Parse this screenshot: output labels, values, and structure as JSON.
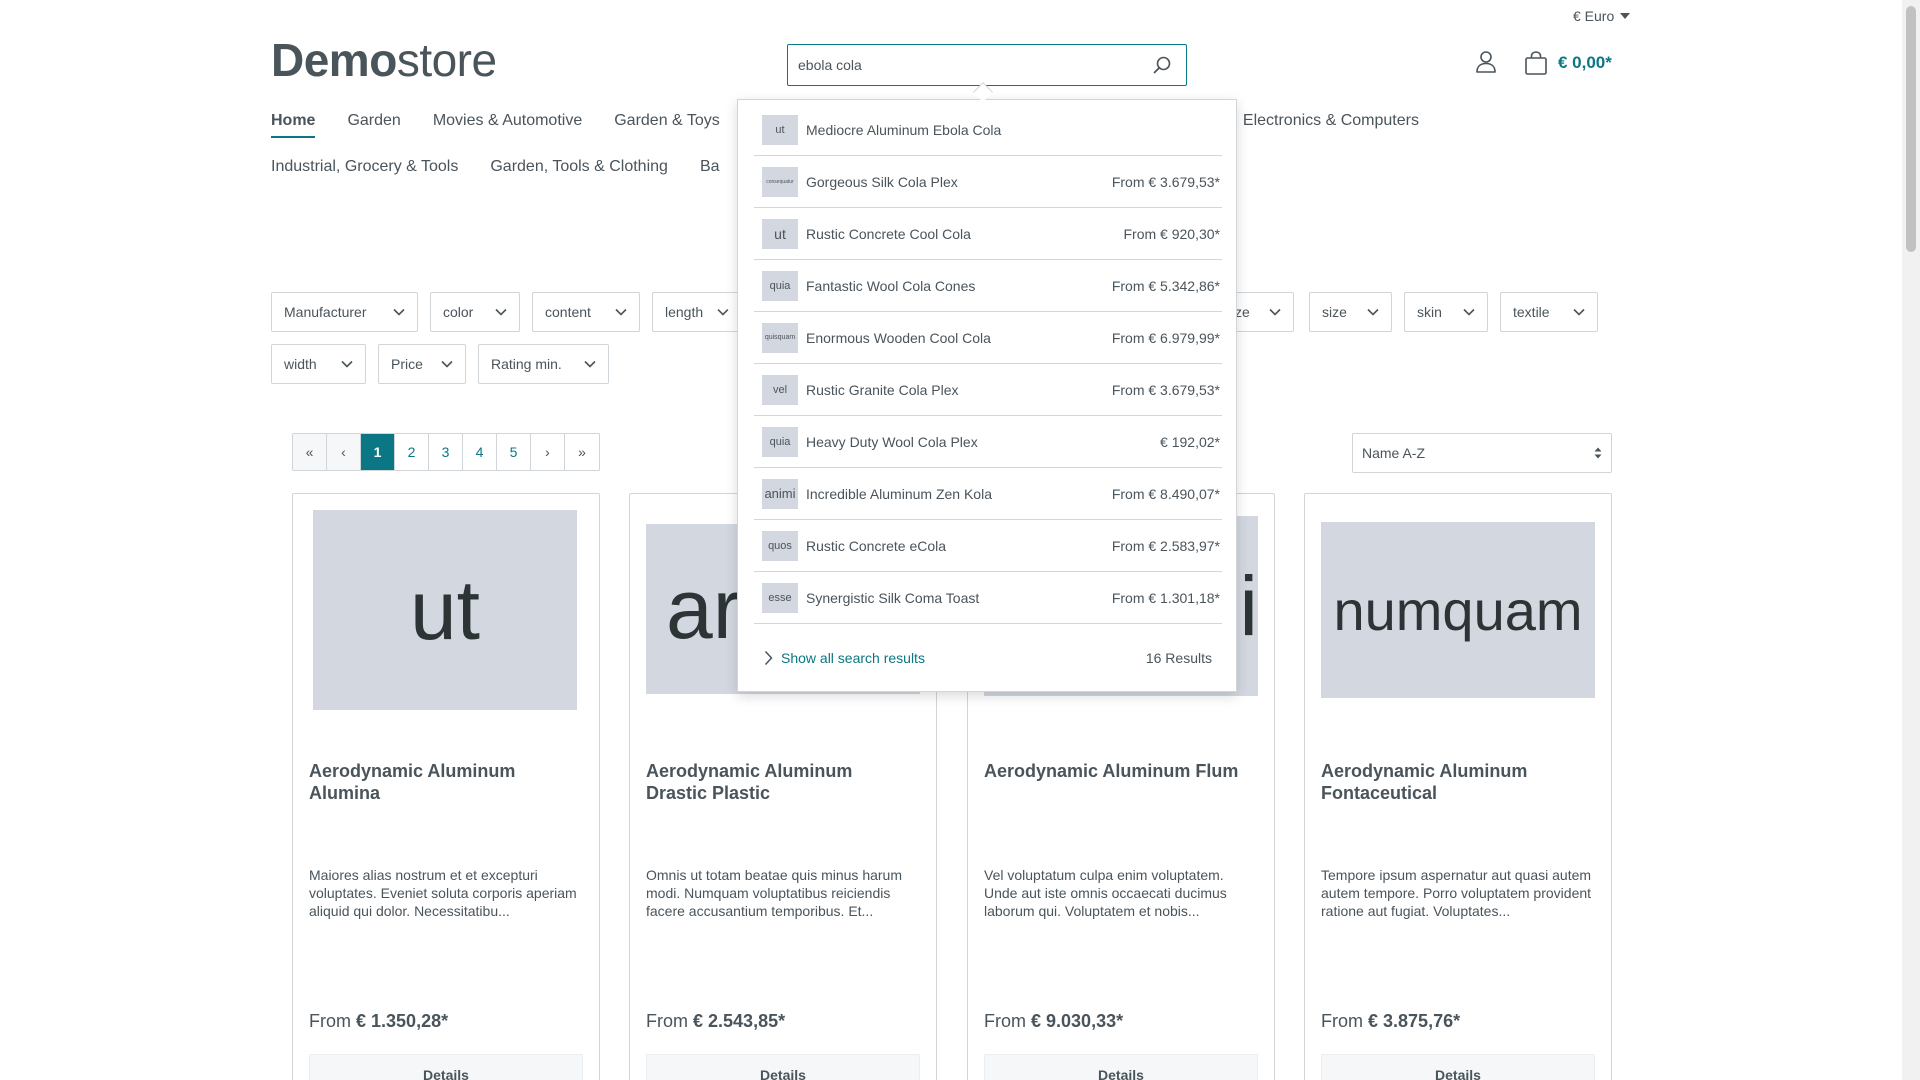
{
  "header": {
    "currency": "€ Euro",
    "logo_bold": "Demo",
    "logo_light": "store",
    "search_value": "ebola cola",
    "cart_total": "€ 0,00*"
  },
  "nav": {
    "row1": [
      "Home",
      "Garden",
      "Movies & Automotive",
      "Garden & Toys"
    ],
    "row1_right": ", Electronics & Computers",
    "row2": [
      "Industrial, Grocery & Tools",
      "Garden, Tools & Clothing",
      "Ba"
    ]
  },
  "filters": {
    "row1": [
      "Manufacturer",
      "color",
      "content",
      "length",
      "ze",
      "size",
      "skin",
      "textile"
    ],
    "row2": [
      "width",
      "Price",
      "Rating min."
    ]
  },
  "pagination": {
    "first": "«",
    "prev": "‹",
    "pages": [
      "1",
      "2",
      "3",
      "4",
      "5"
    ],
    "next": "›",
    "last": "»"
  },
  "sort": {
    "value": "Name A-Z"
  },
  "products": [
    {
      "thumb": "ut",
      "title": "Aerodynamic Aluminum Alumina",
      "desc": "Maiores alias nostrum et et excepturi voluptates. Eveniet soluta corporis aperiam aliquid qui dolor. Necessitatibu...",
      "price_prefix": "From",
      "price": "€ 1.350,28*",
      "button": "Details"
    },
    {
      "thumb": "ar",
      "title": "Aerodynamic Aluminum Drastic Plastic",
      "desc": "Omnis ut totam beatae quis minus harum modi. Numquam voluptatibus reiciendis facere accusantium temporibus. Et...",
      "price_prefix": "From",
      "price": "€ 2.543,85*",
      "button": "Details"
    },
    {
      "thumb": "li",
      "title": "Aerodynamic Aluminum Flum",
      "desc": "Vel voluptatum culpa enim voluptatem. Unde aut iste omnis occaecati ducimus laborum qui. Voluptatem et nobis...",
      "price_prefix": "From",
      "price": "€ 9.030,33*",
      "button": "Details"
    },
    {
      "thumb": "numquam",
      "title": "Aerodynamic Aluminum Fontaceutical",
      "desc": "Tempore ipsum aspernatur aut quasi autem autem tempore. Porro voluptatem provident ratione aut fugiat. Voluptates...",
      "price_prefix": "From",
      "price": "€ 3.875,76*",
      "button": "Details"
    }
  ],
  "suggestions": {
    "items": [
      {
        "thumb": "ut",
        "name": "Mediocre Aluminum Ebola Cola",
        "price": ""
      },
      {
        "thumb": "consequatur",
        "name": "Gorgeous Silk Cola Plex",
        "price": "From € 3.679,53*"
      },
      {
        "thumb": "ut",
        "name": "Rustic Concrete Cool Cola",
        "price": "From € 920,30*"
      },
      {
        "thumb": "quia",
        "name": "Fantastic Wool Cola Cones",
        "price": "From € 5.342,86*"
      },
      {
        "thumb": "quisquam",
        "name": "Enormous Wooden Cool Cola",
        "price": "From € 6.979,99*"
      },
      {
        "thumb": "vel",
        "name": "Rustic Granite Cola Plex",
        "price": "From € 3.679,53*"
      },
      {
        "thumb": "quia",
        "name": "Heavy Duty Wool Cola Plex",
        "price": "€ 192,02*"
      },
      {
        "thumb": "animi",
        "name": "Incredible Aluminum Zen Kola",
        "price": "From € 8.490,07*"
      },
      {
        "thumb": "quos",
        "name": "Rustic Concrete eCola",
        "price": "From € 2.583,97*"
      },
      {
        "thumb": "esse",
        "name": "Synergistic Silk Coma Toast",
        "price": "From € 1.301,18*"
      }
    ],
    "show_all": "Show all search results",
    "result_count": "16 Results"
  },
  "icons": {
    "search": "search-icon",
    "account": "user-icon",
    "cart": "bag-icon",
    "chevron": "chevron-down-icon"
  },
  "colors": {
    "accent": "#0b7784",
    "text": "#4a545b",
    "border": "#d0d5d9",
    "placeholder_bg": "#d3d8e0"
  }
}
